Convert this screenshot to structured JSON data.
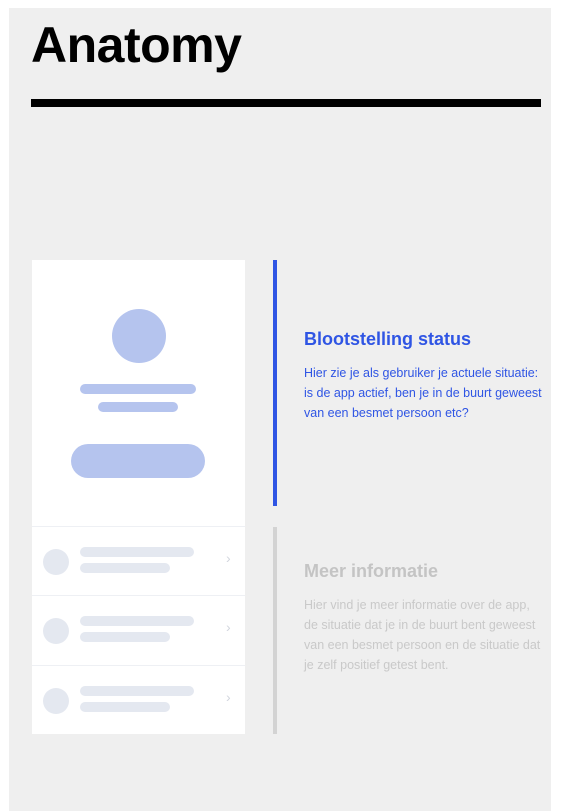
{
  "page": {
    "title": "Anatomy"
  },
  "colors": {
    "accent": "#2f55e4",
    "placeholder_blue": "#b5c4ee",
    "placeholder_grey": "#e4e8f0",
    "muted_text": "#c9c9c9",
    "panel_background": "#efefef"
  },
  "mockup": {
    "list_rows": [
      {
        "chevron": "›"
      },
      {
        "chevron": "›"
      },
      {
        "chevron": "›"
      }
    ]
  },
  "annotations": [
    {
      "title": "Blootstelling status",
      "description": "Hier zie je als gebruiker je actuele situatie: is de app actief, ben je in de buurt geweest van een besmet persoon etc?",
      "state": "active"
    },
    {
      "title": "Meer informatie",
      "description": "Hier vind je meer informatie over de app, de situatie dat je in de buurt bent geweest van een besmet persoon en de situatie dat je zelf positief getest bent.",
      "state": "inactive"
    }
  ]
}
